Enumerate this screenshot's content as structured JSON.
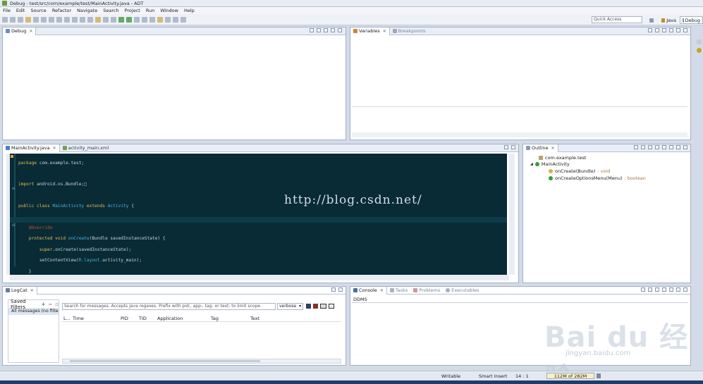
{
  "window": {
    "title": "Debug - test/src/com/example/test/MainActivity.java - ADT"
  },
  "menu": [
    "File",
    "Edit",
    "Source",
    "Refactor",
    "Navigate",
    "Search",
    "Project",
    "Run",
    "Window",
    "Help"
  ],
  "toolbar": {
    "quick_access_placeholder": "Quick Access",
    "perspective_java": "Java",
    "perspective_debug": "Debug"
  },
  "debug_view": {
    "tab": "Debug"
  },
  "variables_view": {
    "tabs": [
      "Variables",
      "Breakpoints"
    ]
  },
  "editor": {
    "tabs": [
      "MainActivity.java",
      "activity_main.xml"
    ],
    "watermark": "http://blog.csdn.net/"
  },
  "outline": {
    "tab": "Outline",
    "items": [
      "com.example.test",
      "MainActivity",
      "onCreate(Bundle)",
      "onCreateOptionsMenu(Menu)"
    ],
    "return_void": " : void",
    "return_boolean": " : boolean"
  },
  "logcat": {
    "tab": "LogCat",
    "saved_filters": "Saved Filters",
    "all_messages": "All messages (no filters)",
    "search_placeholder": "Search for messages. Accepts Java regexes. Prefix with pid:, app:, tag: or text: to limit scope.",
    "level": "verbose",
    "columns": [
      "L...",
      "Time",
      "PID",
      "TID",
      "Application",
      "Tag",
      "Text"
    ]
  },
  "console": {
    "tabs": [
      "Console",
      "Tasks",
      "Problems",
      "Executables"
    ],
    "content": "DDMS"
  },
  "status": {
    "writable": "Writable",
    "insert": "Smart Insert",
    "position": "14 : 1",
    "memory": "112M of 282M"
  },
  "baidu_wm": {
    "logo": "Bai du 经验",
    "url": "jingyan.baidu.com"
  }
}
